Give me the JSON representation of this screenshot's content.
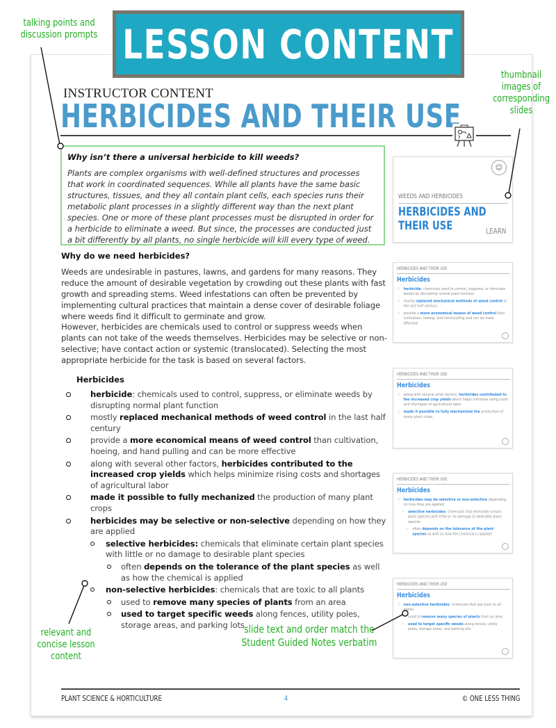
{
  "banner": {
    "title": "LESSON CONTENT",
    "bg_color": "#1fa8c3",
    "border_color": "#7a756a"
  },
  "annotations": {
    "talking_points": "talking points and discussion prompts",
    "thumbnails": "thumbnail images of corresponding slides",
    "relevant": "relevant and concise lesson content",
    "slide_text": "slide text and order match the Student Guided Notes verbatim",
    "color": "#22b022"
  },
  "header": {
    "kicker": "INSTRUCTOR CONTENT",
    "title": "HERBICIDES AND THEIR USE",
    "title_color": "#4a9bcb",
    "icon": "easel-presentation-icon"
  },
  "prompt": {
    "question": "Why isn’t there a universal herbicide to kill weeds?",
    "answer": "Plants are complex organisms with well-defined structures and processes that work in coordinated sequences. While all plants have the same basic structures, tissues, and they all contain plant cells, each species runs their metabolic plant processes in a slightly different way than the next plant species. One or more of these plant processes must be disrupted in order for a herbicide to eliminate a weed.  But since, the processes are conducted just a bit differently by all plants, no single herbicide will kill every type of weed."
  },
  "why": {
    "heading": "Why do we need herbicides?",
    "para1": "Weeds are undesirable in pastures, lawns, and gardens for many reasons. They reduce the amount of desirable vegetation by crowding out these plants with fast growth and spreading stems. Weed infestations can often be prevented by implementing cultural practices that maintain a dense cover of desirable foliage where weeds find it difficult to germinate and grow.",
    "para2": "However, herbicides are chemicals used to control or suppress weeds when plants can not take of the weeds themselves. Herbicides may be selective or non-selective; have contact action or systemic (translocated). Selecting the most appropriate herbicide for the task is based on several factors."
  },
  "herbicides": {
    "heading": "Herbicides",
    "bullets": [
      {
        "level": 1,
        "bold": "herbicide",
        "text": ": chemicals used to control, suppress, or eliminate weeds by disrupting normal plant function"
      },
      {
        "level": 1,
        "pre": "mostly ",
        "bold": "replaced mechanical methods of weed control",
        "text": " in the last half century"
      },
      {
        "level": 1,
        "pre": "provide a ",
        "bold": "more economical means of weed control",
        "text": " than cultivation, hoeing, and hand pulling and can be more effective"
      },
      {
        "level": 1,
        "pre": "along with several other factors, ",
        "bold": "herbicides contributed to the increased crop yields",
        "text": " which helps minimize rising costs and shortages of agricultural labor"
      },
      {
        "level": 1,
        "bold": "made it possible to fully mechanized",
        "text": " the production of many plant crops"
      },
      {
        "level": 1,
        "bold": "herbicides may be selective or non-selective",
        "text": " depending on how they are applied"
      },
      {
        "level": 2,
        "bold": "selective herbicides:",
        "text": " chemicals that eliminate certain plant species with little or no damage to desirable plant species"
      },
      {
        "level": 3,
        "pre": "often ",
        "bold": "depends on the tolerance of the plant species",
        "text": " as well as how the chemical is applied"
      },
      {
        "level": 2,
        "bold": "non-selective herbicides",
        "text": ": chemicals that are toxic to all plants"
      },
      {
        "level": 3,
        "pre": "used to ",
        "bold": "remove many species of plants",
        "text": " from an area"
      },
      {
        "level": 3,
        "bold": "used to target specific weeds",
        "text": " along fences, utility poles, storage areas, and parking lots"
      }
    ]
  },
  "slides": {
    "title_slide": {
      "subtitle": "WEEDS AND HERBICIDES",
      "title": "HERBICIDES AND THEIR USE",
      "tag": "LEARN"
    },
    "content_header": "HERBICIDES AND THEIR USE",
    "content_title": "Herbicides",
    "slide2": [
      {
        "level": 1,
        "hl": "herbicide",
        "text": ": chemicals used to control, suppress, or eliminate weeds by disrupting normal plant function"
      },
      {
        "level": 1,
        "pre": "mostly ",
        "hl": "replaced mechanical methods of weed control",
        "text": " in the last half century"
      },
      {
        "level": 1,
        "pre": "provide a ",
        "hl": "more economical means of weed control",
        "text": " than cultivation, hoeing, and hand pulling and can be more effective"
      }
    ],
    "slide3": [
      {
        "level": 1,
        "pre": "along with several other factors, ",
        "hl": "herbicides contributed to the increased crop yields",
        "text": " which helps minimize rising costs and shortages of agricultural labor"
      },
      {
        "level": 1,
        "hl": "made it possible to fully mechanized the",
        "text": " production of many plant crops"
      }
    ],
    "slide4": [
      {
        "level": 1,
        "hl": "herbicides may be selective or non-selective",
        "text": " depending on how they are applied"
      },
      {
        "level": 2,
        "hl": "selective herbicides",
        "text": ": chemicals that eliminate certain plant species with little or no damage to desirable plant species"
      },
      {
        "level": 3,
        "pre": "often ",
        "hl": "depends on the tolerance of the plant species",
        "text": " as well as how the chemical is applied"
      }
    ],
    "slide5": [
      {
        "level": 1,
        "hl": "non-selective herbicides",
        "text": ": chemicals that are toxic to all plants"
      },
      {
        "level": 2,
        "pre": "used to ",
        "hl": "remove many species of plants",
        "text": " from an area"
      },
      {
        "level": 2,
        "hl": "used to target specific weeds",
        "text": " along fences, utility poles, storage areas, and parking lots"
      }
    ]
  },
  "footer": {
    "left": "PLANT SCIENCE & HORTICULTURE",
    "page": "4",
    "right": "© ONE LESS THING"
  }
}
